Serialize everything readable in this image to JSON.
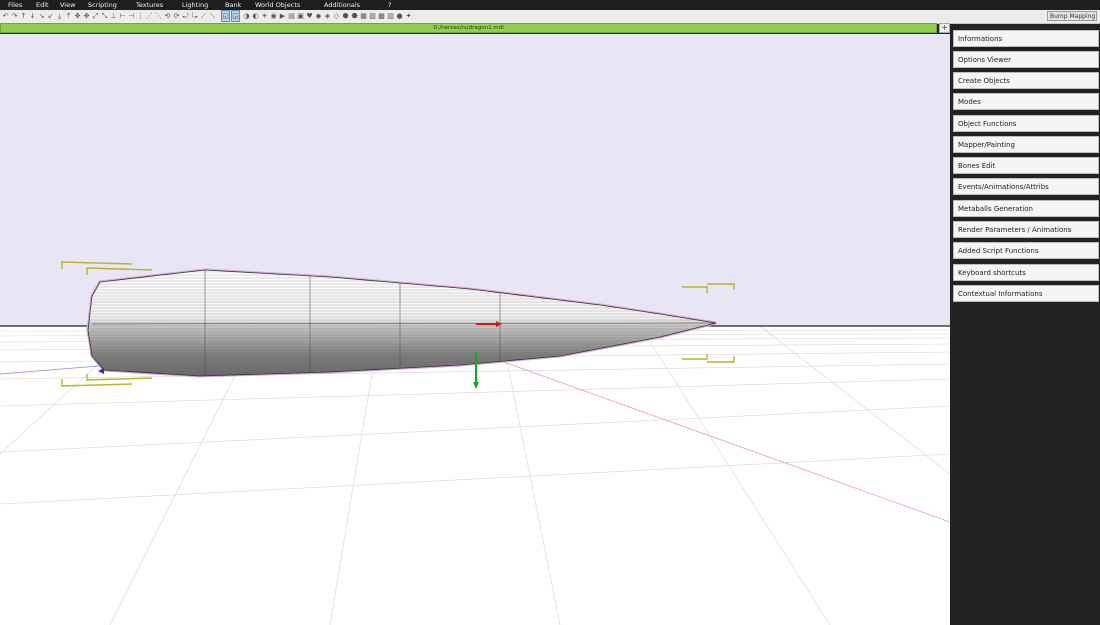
{
  "menu": [
    "Files",
    "Edit",
    "View",
    "Scripting",
    "Textures",
    "Lighting",
    "Bank",
    "World Objects",
    "Additionals",
    "?"
  ],
  "toolbar": {
    "render_mode": "Bump Mapping"
  },
  "path_bar": {
    "path": "D:/heroes/rs/dragon1.mdl",
    "plus_label": "+"
  },
  "side_panel": {
    "items": [
      "Informations",
      "Options Viewer",
      "Create Objects",
      "Modes",
      "Object Functions",
      "Mapper/Painting",
      "Bones Edit",
      "Events/Animations/Attribs",
      "Metaballs Generation",
      "Render Parameters / Animations",
      "Added Script Functions",
      "Keyboard shortcuts",
      "Contextual Informations"
    ]
  },
  "colors": {
    "sky": "#e8e5f5",
    "floor": "#ffffff",
    "path_bar": "#8fcf4c",
    "selection_outline": "#d7a8d6",
    "bbox_corners": "#b5b52a",
    "axis_x": "#cc1b1b",
    "axis_y": "#12a82a",
    "axis_z": "#2233cc",
    "panel_bg": "#222222"
  }
}
